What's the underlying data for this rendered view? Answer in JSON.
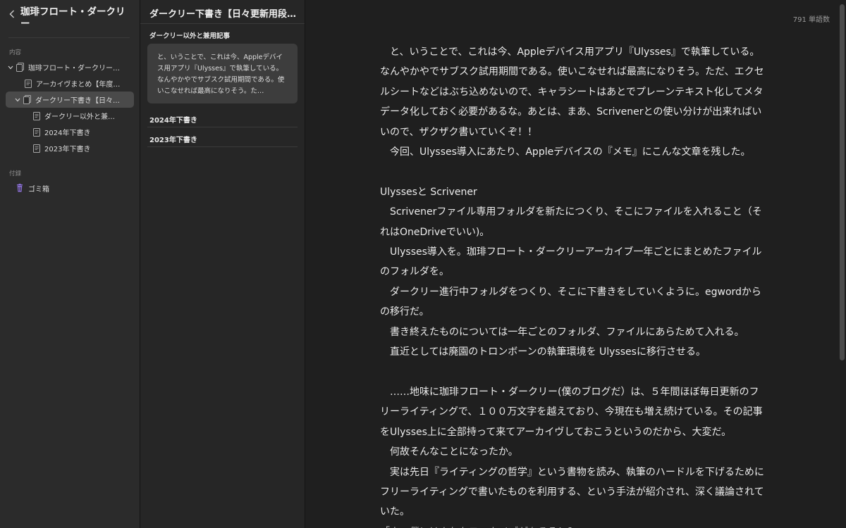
{
  "sidebar": {
    "title": "珈琲フロート・ダークリー",
    "section_contents": "内容",
    "section_attachments": "付録",
    "tree": [
      {
        "label": "珈琲フロート・ダークリー…",
        "level": 0,
        "chevron": true,
        "selected": false
      },
      {
        "label": "アーカイヴまとめ【年度…",
        "level": 1,
        "chevron": false,
        "selected": false
      },
      {
        "label": "ダークリー下書き【日々…",
        "level": 1,
        "chevron": true,
        "selected": true
      },
      {
        "label": "ダークリー以外と兼…",
        "level": 2,
        "chevron": false,
        "selected": false
      },
      {
        "label": "2024年下書き",
        "level": 2,
        "chevron": false,
        "selected": false
      },
      {
        "label": "2023年下書き",
        "level": 2,
        "chevron": false,
        "selected": false
      }
    ],
    "trash_label": "ゴミ箱"
  },
  "sheets": {
    "header": "ダークリー下書き【日々更新用段…",
    "group_label": "ダークリー以外と兼用記事",
    "card_preview": "と、いうことで、これは今、Appleデバイス用アプリ『Ulysses』で執筆している。なんやかやでサブスク試用期間である。使いこなせれば最高になりそう。た…",
    "rows": [
      "2024年下書き",
      "2023年下書き"
    ]
  },
  "editor": {
    "word_count": "791 単語数",
    "paragraphs": [
      "　と、いうことで、これは今、Appleデバイス用アプリ『Ulysses』で執筆している。なんやかやでサブスク試用期間である。使いこなせれば最高になりそう。ただ、エクセルシートなどはぶち込めないので、キャラシートはあとでプレーンテキスト化してメタデータ化しておく必要があるな。あとは、まあ、Scrivenerとの使い分けが出来ればいいので、ザクザク書いていくぞ！！",
      "　今回、Ulysses導入にあたり、Appleデバイスの『メモ』にこんな文章を残した。",
      "",
      " Ulyssesと Scrivener",
      "　Scrivenerファイル専用フォルダを新たにつくり、そこにファイルを入れること（それはOneDriveでいい)。",
      "　Ulysses導入を。珈琲フロート・ダークリーアーカイブ一年ごとにまとめたファイルのフォルダを。",
      "　ダークリー進行中フォルダをつくり、そこに下書きをしていくように。egwordからの移行だ。",
      "　書き終えたものについては一年ごとのフォルダ、ファイルにあらためて入れる。",
      "　直近としては廃園のトロンボーンの執筆環境を Ulyssesに移行させる。",
      "",
      "　……地味に珈琲フロート・ダークリー(僕のブログだ）は、５年間ほぼ毎日更新のフリーライティングで、１００万文字を越えており、今現在も増え続けている。その記事をUlysses上に全部持って来てアーカイヴしておこうというのだから、大変だ。",
      "　何故そんなことになったか。",
      "　実は先日『ライティングの哲学』という書物を読み、執筆のハードルを下げるためにフリーライティングで書いたものを利用する、という手法が紹介され、深く議論されていた。",
      "「ウ　僕にはよれもフーカイブがあるぞ！？"
    ]
  },
  "colors": {
    "sidebar_bg": "#2b2b2b",
    "list_bg": "#262626",
    "editor_bg": "#1f1f1f",
    "selection": "#4a4a4a",
    "trash_icon": "#8b6fd6"
  }
}
